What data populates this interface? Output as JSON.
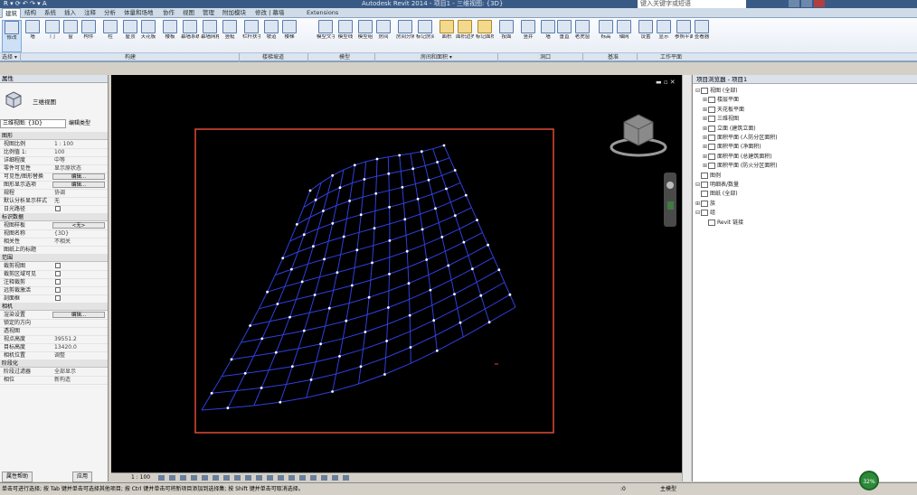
{
  "titlebar": {
    "qat": "R  ▾  ⟳  ↶ ↷  ▾  A",
    "title": "Autodesk Revit 2014  -  项目1 - 三维视图: {3D}",
    "search_placeholder": "键入关键字或短语",
    "window_controls": [
      "_",
      "□",
      "×"
    ]
  },
  "tabs": [
    {
      "label": "建筑",
      "active": true
    },
    {
      "label": "结构"
    },
    {
      "label": "系统"
    },
    {
      "label": "插入"
    },
    {
      "label": "注释"
    },
    {
      "label": "分析"
    },
    {
      "label": "体量和场地"
    },
    {
      "label": "协作"
    },
    {
      "label": "视图"
    },
    {
      "label": "管理"
    },
    {
      "label": "附加模块"
    },
    {
      "label": "修改 | 幕墙"
    },
    {
      "label": "Extensions"
    }
  ],
  "ribbon": {
    "buttons": [
      "修改",
      "墙",
      "门",
      "窗",
      "构件",
      "柱",
      "屋顶",
      "天花板",
      "楼板",
      "幕墙系统",
      "幕墙网格",
      "竖梃",
      "栏杆扶手",
      "坡道",
      "楼梯",
      "模型文字",
      "模型线",
      "模型组",
      "房间",
      "房间分隔",
      "标记房间",
      "面积",
      "面积边界",
      "标记面积",
      "按面",
      "竖井",
      "墙",
      "垂直",
      "老虎窗",
      "标高",
      "轴网",
      "设置",
      "显示",
      "参照平面",
      "查看器"
    ],
    "panels": [
      "选择 ▾",
      "构建",
      "楼梯坡道",
      "模型",
      "房间和面积 ▾",
      "洞口",
      "基准",
      "工作平面"
    ]
  },
  "properties": {
    "title": "属性",
    "type_name": "三维视图",
    "selector": "三维视图: {3D}",
    "edit_type": "编辑类型",
    "sections": [
      {
        "header": "图形",
        "rows": [
          {
            "k": "视图比例",
            "v": "1 : 100"
          },
          {
            "k": "比例值 1:",
            "v": "100"
          },
          {
            "k": "详细程度",
            "v": "中等"
          },
          {
            "k": "零件可见性",
            "v": "显示原状态"
          },
          {
            "k": "可见性/图形替换",
            "v": "编辑...",
            "btn": true
          },
          {
            "k": "图形显示选项",
            "v": "编辑...",
            "btn": true
          },
          {
            "k": "规程",
            "v": "协调"
          },
          {
            "k": "默认分析显示样式",
            "v": "无"
          },
          {
            "k": "日光路径",
            "v": "",
            "chk": true
          }
        ]
      },
      {
        "header": "标识数据",
        "rows": [
          {
            "k": "视图样板",
            "v": "<无>",
            "btn": true
          },
          {
            "k": "视图名称",
            "v": "{3D}"
          },
          {
            "k": "相关性",
            "v": "不相关"
          },
          {
            "k": "图纸上的标题",
            "v": ""
          }
        ]
      },
      {
        "header": "范围",
        "rows": [
          {
            "k": "裁剪视图",
            "v": "",
            "chk": true
          },
          {
            "k": "裁剪区域可见",
            "v": "",
            "chk": true
          },
          {
            "k": "注释裁剪",
            "v": "",
            "chk": true
          },
          {
            "k": "远剪裁激活",
            "v": "",
            "chk": true
          },
          {
            "k": "剖面框",
            "v": "",
            "chk": true
          }
        ]
      },
      {
        "header": "相机",
        "rows": [
          {
            "k": "渲染设置",
            "v": "编辑...",
            "btn": true
          },
          {
            "k": "锁定的方向",
            "v": ""
          },
          {
            "k": "透视图",
            "v": ""
          },
          {
            "k": "视点高度",
            "v": "39551.2"
          },
          {
            "k": "目标高度",
            "v": "13420.0"
          },
          {
            "k": "相机位置",
            "v": "调整"
          }
        ]
      },
      {
        "header": "阶段化",
        "rows": [
          {
            "k": "阶段过滤器",
            "v": "全部显示"
          },
          {
            "k": "相位",
            "v": "新构造"
          }
        ]
      }
    ],
    "help_link": "属性帮助",
    "apply": "应用"
  },
  "viewport": {
    "scale": "1 : 100"
  },
  "browser": {
    "title": "项目浏览器 - 项目1",
    "nodes": [
      {
        "label": "视图 (全部)",
        "level": 0,
        "toggle": "⊟"
      },
      {
        "label": "楼层平面",
        "level": 1,
        "toggle": "⊞"
      },
      {
        "label": "天花板平面",
        "level": 1,
        "toggle": "⊞"
      },
      {
        "label": "三维视图",
        "level": 1,
        "toggle": "⊞"
      },
      {
        "label": "立面 (建筑立面)",
        "level": 1,
        "toggle": "⊞"
      },
      {
        "label": "面积平面 (人防分区面积)",
        "level": 1,
        "toggle": "⊞"
      },
      {
        "label": "面积平面 (净面积)",
        "level": 1,
        "toggle": "⊞"
      },
      {
        "label": "面积平面 (总建筑面积)",
        "level": 1,
        "toggle": "⊞"
      },
      {
        "label": "面积平面 (防火分区面积)",
        "level": 1,
        "toggle": "⊞"
      },
      {
        "label": "图例",
        "level": 0,
        "toggle": ""
      },
      {
        "label": "明细表/数量",
        "level": 0,
        "toggle": "⊟"
      },
      {
        "label": "图纸 (全部)",
        "level": 0,
        "toggle": ""
      },
      {
        "label": "族",
        "level": 0,
        "toggle": "⊞"
      },
      {
        "label": "组",
        "level": 0,
        "toggle": "⊟"
      },
      {
        "label": "Revit 链接",
        "level": 1,
        "toggle": ""
      }
    ]
  },
  "statusbar": {
    "message": "单击可进行选择; 按 Tab 键并单击可选择其他项目; 按 Ctrl 键并单击可将新项目添加到选择集; 按 Shift 键并单击可取消选择。",
    "zoom": ":0",
    "model": "主模型",
    "progress_pct": "32%"
  },
  "colors": {
    "crop_frame": "#e04a35",
    "grid_lines": "#2f3fe0",
    "grid_nodes": "#ffffff",
    "viewport_bg": "#000000",
    "progress": "#2d8a3a"
  }
}
